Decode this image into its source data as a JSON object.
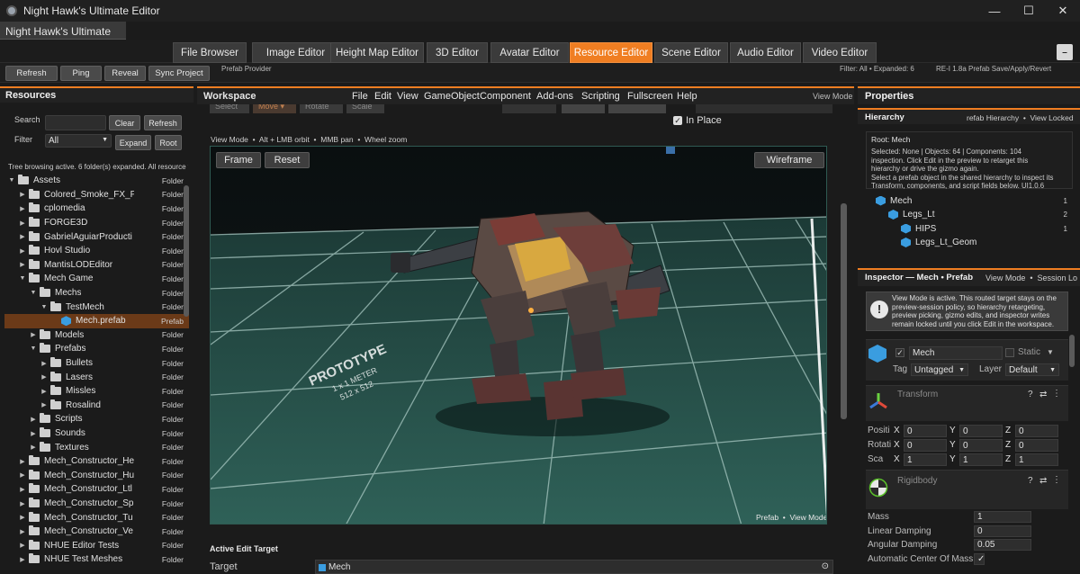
{
  "window": {
    "title": "Night Hawk's Ultimate Editor",
    "app_tab": "Night Hawk's Ultimate Editor",
    "controls": {
      "minimize": "—",
      "maximize": "☐",
      "close": "✕"
    }
  },
  "editor_tabs": [
    "File Browser",
    "Image Editor",
    "Height Map Editor",
    "3D Editor",
    "Avatar Editor",
    "Resource Editor",
    "Scene Editor",
    "Audio Editor",
    "Video Editor"
  ],
  "editor_tab_menu": "–",
  "toolbar": {
    "buttons": [
      "Refresh",
      "Ping",
      "Reveal",
      "Sync Project"
    ],
    "provider": "Prefab Provider",
    "filter_status": "Filter: All • Expanded: 6",
    "version_status": "RE-I 1.8a Prefab Save/Apply/Revert"
  },
  "resources": {
    "title": "Resources",
    "search_label": "Search",
    "clear": "Clear",
    "refresh": "Refresh",
    "filter_label": "Filter",
    "filter_value": "All",
    "expand": "Expand",
    "root": "Root",
    "status": "Tree browsing active. 6 folder(s) expanded. All resource t",
    "tree": [
      {
        "name": "Assets",
        "type": "Folder",
        "depth": 0,
        "open": true
      },
      {
        "name": "Colored_Smoke_FX_P",
        "type": "Folder",
        "depth": 1
      },
      {
        "name": "cplomedia",
        "type": "Folder",
        "depth": 1
      },
      {
        "name": "FORGE3D",
        "type": "Folder",
        "depth": 1
      },
      {
        "name": "GabrielAguiarProducti",
        "type": "Folder",
        "depth": 1
      },
      {
        "name": "Hovl Studio",
        "type": "Folder",
        "depth": 1
      },
      {
        "name": "MantisLODEditor",
        "type": "Folder",
        "depth": 1
      },
      {
        "name": "Mech Game",
        "type": "Folder",
        "depth": 1,
        "open": true
      },
      {
        "name": "Mechs",
        "type": "Folder",
        "depth": 2,
        "open": true
      },
      {
        "name": "TestMech",
        "type": "Folder",
        "depth": 3,
        "open": true
      },
      {
        "name": "Mech.prefab",
        "type": "Prefab",
        "depth": 4,
        "selected": true
      },
      {
        "name": "Models",
        "type": "Folder",
        "depth": 2
      },
      {
        "name": "Prefabs",
        "type": "Folder",
        "depth": 2,
        "open": true
      },
      {
        "name": "Bullets",
        "type": "Folder",
        "depth": 3
      },
      {
        "name": "Lasers",
        "type": "Folder",
        "depth": 3
      },
      {
        "name": "Missles",
        "type": "Folder",
        "depth": 3
      },
      {
        "name": "Rosalind",
        "type": "Folder",
        "depth": 3
      },
      {
        "name": "Scripts",
        "type": "Folder",
        "depth": 2
      },
      {
        "name": "Sounds",
        "type": "Folder",
        "depth": 2
      },
      {
        "name": "Textures",
        "type": "Folder",
        "depth": 2
      },
      {
        "name": "Mech_Constructor_He",
        "type": "Folder",
        "depth": 1
      },
      {
        "name": "Mech_Constructor_Hu",
        "type": "Folder",
        "depth": 1
      },
      {
        "name": "Mech_Constructor_Ltl",
        "type": "Folder",
        "depth": 1
      },
      {
        "name": "Mech_Constructor_Sp",
        "type": "Folder",
        "depth": 1
      },
      {
        "name": "Mech_Constructor_Tu",
        "type": "Folder",
        "depth": 1
      },
      {
        "name": "Mech_Constructor_Ve",
        "type": "Folder",
        "depth": 1
      },
      {
        "name": "NHUE Editor Tests",
        "type": "Folder",
        "depth": 1
      },
      {
        "name": "NHUE Test Meshes",
        "type": "Folder",
        "depth": 1
      }
    ]
  },
  "workspace": {
    "title": "Workspace",
    "menu": [
      "File",
      "Edit",
      "View",
      "GameObject",
      "Component",
      "Add-ons",
      "Scripting",
      "Fullscreen",
      "Help"
    ],
    "mode": "View Mode",
    "tools": [
      "Select",
      "Move ▾",
      "Rotate",
      "Scale"
    ],
    "in_place": "In Place",
    "hints": "View Mode  •  Alt + LMB orbit  •  MMB pan  •  Wheel zoom",
    "frame": "Frame",
    "reset": "Reset",
    "wireframe": "Wireframe",
    "grid_text": [
      "PROTOTYPE",
      "1 x 1 METER",
      "512 x 512"
    ],
    "overlay": "Prefab  •  View Mode",
    "active_edit": "Active Edit Target",
    "target_label": "Target",
    "target_value": "Mech"
  },
  "properties": {
    "title": "Properties",
    "hierarchy": "Hierarchy",
    "hierarchy_meta": "refab Hierarchy  •  View Locked",
    "root": "Root: Mech",
    "stats": "Selected: None  |  Objects: 64  |  Components: 104",
    "info1": "inspection. Click Edit in the preview to retarget this",
    "info2": "hierarchy or drive the gizmo again.",
    "info3": "Select a prefab object in the shared hierarchy to inspect its",
    "info4": "Transform, components, and script fields below. UI1.0.6",
    "nodes": [
      {
        "name": "Mech",
        "count": "1",
        "depth": 0
      },
      {
        "name": "Legs_Lt",
        "count": "2",
        "depth": 1
      },
      {
        "name": "HIPS",
        "count": "1",
        "depth": 2
      },
      {
        "name": "Legs_Lt_Geom",
        "count": "",
        "depth": 2
      }
    ],
    "inspector": "Inspector — Mech • Prefab",
    "inspector_meta": "View Mode  •  Session Lo",
    "notice": "View Mode is active. This routed target stays on the preview-session policy, so hierarchy retargeting, preview picking, gizmo edits, and inspector writes remain locked until you click Edit in the workspace.",
    "object_name": "Mech",
    "static": "Static",
    "tag_label": "Tag",
    "tag": "Untagged",
    "layer_label": "Layer",
    "layer": "Default",
    "transform": "Transform",
    "rows": [
      {
        "label": "Positi",
        "x": "0",
        "y": "0",
        "z": "0"
      },
      {
        "label": "Rotati",
        "x": "0",
        "y": "0",
        "z": "0"
      },
      {
        "label": "Sca",
        "x": "1",
        "y": "1",
        "z": "1"
      }
    ],
    "axis": [
      "X",
      "Y",
      "Z"
    ],
    "rigidbody": "Rigidbody",
    "rb": [
      {
        "label": "Mass",
        "value": "1"
      },
      {
        "label": "Linear Damping",
        "value": "0"
      },
      {
        "label": "Angular Damping",
        "value": "0.05"
      },
      {
        "label": "Automatic Center Of Mass",
        "value": "✓"
      }
    ]
  }
}
